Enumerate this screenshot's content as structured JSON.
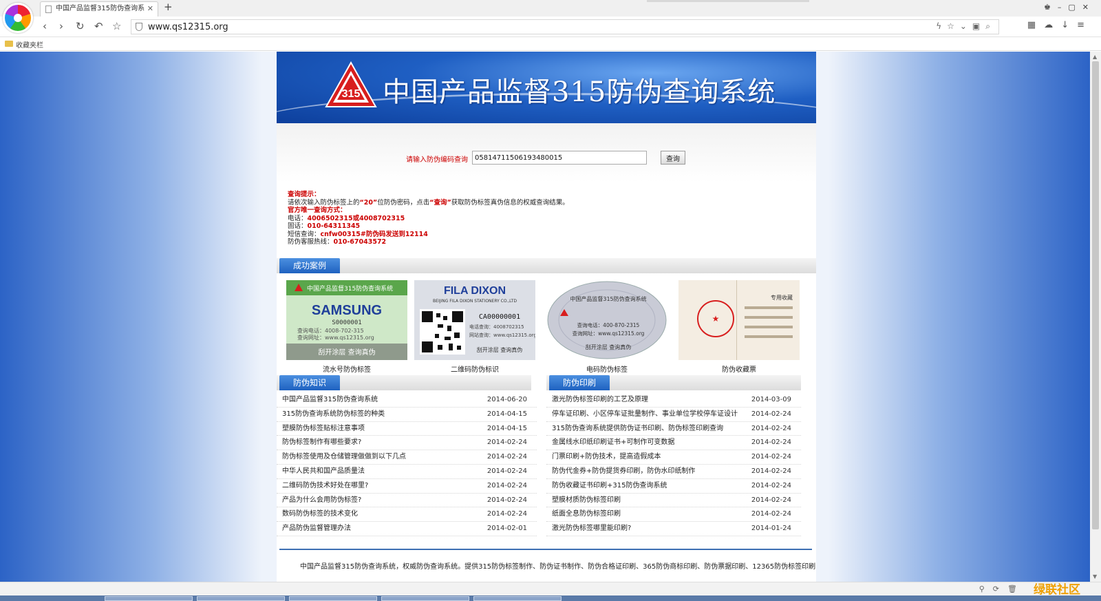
{
  "browser": {
    "tab_title": "中国产品监督315防伪查询系",
    "url": "www.qs12315.org",
    "bookmark_folder": "收藏夹栏",
    "watermark": "绿联社区"
  },
  "site": {
    "banner_logo_text": "315",
    "banner_title": "中国产品监督315防伪查询系统"
  },
  "search": {
    "label": "请输入防伪编码查询",
    "value": "05814711506193480015",
    "button": "查询"
  },
  "tips": {
    "heading": "查询提示：",
    "line1_pre": "请依次输入防伪标签上的",
    "line1_digits": "“20”",
    "line1_mid": "位防伪密码，点击",
    "line1_btn": "“查询”",
    "line1_post": "获取防伪标签真伪信息的权威查询结果。",
    "official_heading": "官方唯一查询方式：",
    "phone_label": "电话：",
    "phone_value": "4006502315或4008702315",
    "fax_label": "固话：",
    "fax_value": "010-64311345",
    "sms_label": "短信查询：",
    "sms_value": "cnfw00315#防伪码发送到12114",
    "hotline_label": "防伪客服热线：",
    "hotline_value": "010-67043572"
  },
  "cases": {
    "title": "成功案例",
    "items": [
      {
        "label": "流水号防伪标签",
        "img_header": "中国产品监督315防伪查询系统",
        "img_brand": "SAMSUNG",
        "img_code": "S0000001",
        "img_phone": "查询电话：4008-702-315",
        "img_site": "查询网址：www.qs12315.org",
        "img_footer": "刮开涂层  查询真伪"
      },
      {
        "label": "二维码防伪标识",
        "img_brand": "FILA DIXON",
        "img_company": "BEIJING FILA DIXON STATIONERY CO.,LTD",
        "img_code": "CA00000001",
        "img_phone": "电话查询：4008702315",
        "img_site": "网站查询：www.qs12315.org",
        "img_footer": "刮开涂层  查询真伪"
      },
      {
        "label": "电码防伪标签",
        "img_header": "中国产品监督315防伪查询系统",
        "img_phone": "查询电话：400-870-2315",
        "img_site": "查询网址：www.qs12315.org",
        "img_footer": "刮开涂层  查询真伪"
      },
      {
        "label": "防伪收藏票",
        "img_stamp": "专用收藏"
      }
    ]
  },
  "knowledge": {
    "title": "防伪知识",
    "items": [
      {
        "title": "中国产品监督315防伪查询系统",
        "date": "2014-06-20"
      },
      {
        "title": "315防伪查询系统防伪标签的种类",
        "date": "2014-04-15"
      },
      {
        "title": "塑膜防伪标签贴标注意事项",
        "date": "2014-04-15"
      },
      {
        "title": "防伪标签制作有哪些要求?",
        "date": "2014-02-24"
      },
      {
        "title": "防伪标签使用及仓储管理做做到以下几点",
        "date": "2014-02-24"
      },
      {
        "title": "中华人民共和国产品质量法",
        "date": "2014-02-24"
      },
      {
        "title": "二维码防伪技术好处在哪里?",
        "date": "2014-02-24"
      },
      {
        "title": "产品为什么会用防伪标签?",
        "date": "2014-02-24"
      },
      {
        "title": "数码防伪标签的技术变化",
        "date": "2014-02-24"
      },
      {
        "title": "产品防伪监督管理办法",
        "date": "2014-02-01"
      }
    ]
  },
  "printing": {
    "title": "防伪印刷",
    "items": [
      {
        "title": "激光防伪标签印刷的工艺及原理",
        "date": "2014-03-09"
      },
      {
        "title": "停车证印刷、小区停车证批量制作、事业单位学校停车证设计",
        "date": "2014-02-24"
      },
      {
        "title": "315防伪查询系统提供防伪证书印刷、防伪标签印刷查询",
        "date": "2014-02-24"
      },
      {
        "title": "金属线水印纸印刷证书+可制作可变数据",
        "date": "2014-02-24"
      },
      {
        "title": "门票印刷+防伪技术，提高造假成本",
        "date": "2014-02-24"
      },
      {
        "title": "防伪代金券+防伪提货券印刷，防伪水印纸制作",
        "date": "2014-02-24"
      },
      {
        "title": "防伪收藏证书印刷+315防伪查询系统",
        "date": "2014-02-24"
      },
      {
        "title": "塑膜材质防伪标签印刷",
        "date": "2014-02-24"
      },
      {
        "title": "纸面全息防伪标签印刷",
        "date": "2014-02-24"
      },
      {
        "title": "激光防伪标签哪里能印刷?",
        "date": "2014-01-24"
      }
    ]
  },
  "footer": {
    "text": "中国产品监督315防伪查询系统，权威防伪查询系统。提供315防伪标签制作、防伪证书制作、防伪合格证印刷、365防伪商标印刷、防伪票据印刷、12365防伪标签印刷"
  }
}
